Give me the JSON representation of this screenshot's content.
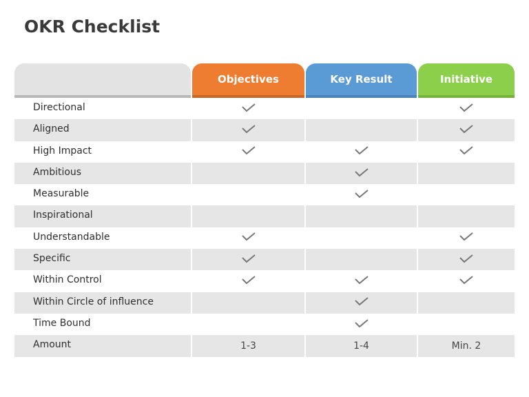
{
  "title": "OKR Checklist",
  "columns": [
    {
      "label": "Objectives",
      "color": "#ee7d31"
    },
    {
      "label": "Key Result",
      "color": "#5b9bd5"
    },
    {
      "label": "Initiative",
      "color": "#8ccf4a"
    }
  ],
  "header_underline_colors": [
    "#c8672a",
    "#4a84ba",
    "#76b33c"
  ],
  "check_icon": "checkmark-icon",
  "rows": [
    {
      "label": "Directional",
      "checks": [
        true,
        false,
        true
      ]
    },
    {
      "label": "Aligned",
      "checks": [
        true,
        false,
        true
      ]
    },
    {
      "label": "High Impact",
      "checks": [
        true,
        true,
        true
      ]
    },
    {
      "label": "Ambitious",
      "checks": [
        false,
        true,
        false
      ]
    },
    {
      "label": "Measurable",
      "checks": [
        false,
        true,
        false
      ]
    },
    {
      "label": "Inspirational",
      "checks": [
        false,
        false,
        false
      ]
    },
    {
      "label": "Understandable",
      "checks": [
        true,
        false,
        true
      ]
    },
    {
      "label": "Specific",
      "checks": [
        true,
        false,
        true
      ]
    },
    {
      "label": "Within Control",
      "checks": [
        true,
        true,
        true
      ]
    },
    {
      "label": "Within Circle of influence",
      "checks": [
        false,
        true,
        false
      ]
    },
    {
      "label": "Time Bound",
      "checks": [
        false,
        true,
        false
      ]
    }
  ],
  "amount": {
    "label": "Amount",
    "values": [
      "1-3",
      "1-4",
      "Min. 2"
    ]
  }
}
